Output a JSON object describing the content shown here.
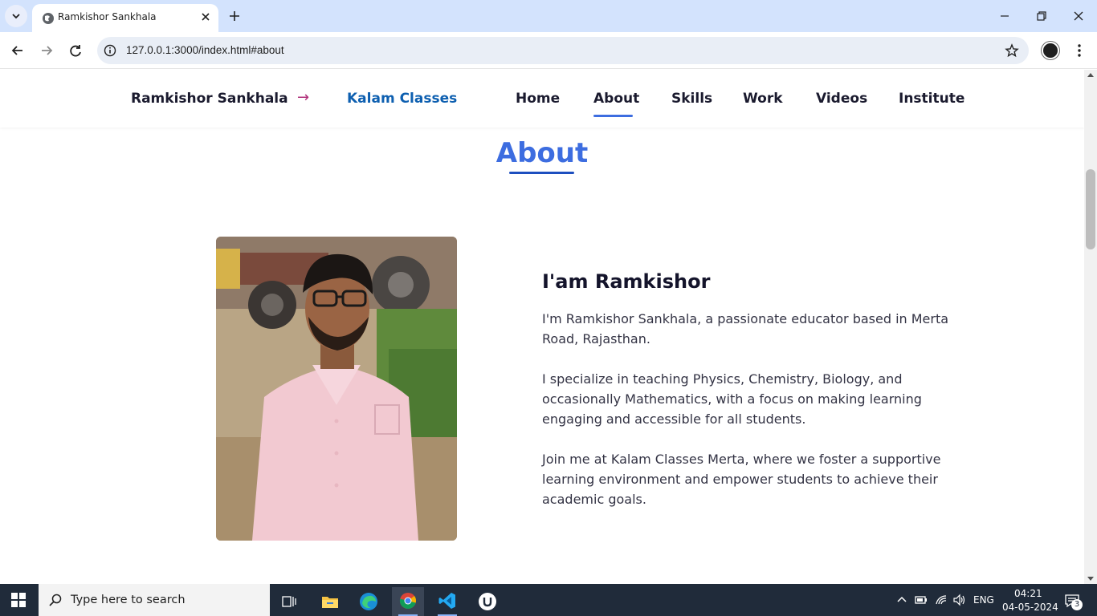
{
  "browser": {
    "tab_title": "Ramkishor Sankhala",
    "url": "127.0.0.1:3000/index.html#about"
  },
  "site": {
    "brand_name": "Ramkishor Sankhala",
    "brand_arrow": "→",
    "brand_link": "Kalam Classes",
    "nav": [
      {
        "label": "Home"
      },
      {
        "label": "About",
        "active": true
      },
      {
        "label": "Skills"
      },
      {
        "label": "Work"
      },
      {
        "label": "Videos"
      },
      {
        "label": "Institute"
      }
    ]
  },
  "about": {
    "section_title": "About",
    "heading": "I'am Ramkishor",
    "paragraphs": [
      "I'm Ramkishor Sankhala, a passionate educator based in Merta Road, Rajasthan.",
      "I specialize in teaching Physics, Chemistry, Biology, and occasionally Mathematics, with a focus on making learning engaging and accessible for all students.",
      "Join me at Kalam Classes Merta, where we foster a supportive learning environment and empower students to achieve their academic goals."
    ]
  },
  "taskbar": {
    "search_placeholder": "Type here to search",
    "language": "ENG",
    "time": "04:21",
    "date": "04-05-2024",
    "notification_count": "3"
  },
  "colors": {
    "accent": "#3d6de0",
    "brand_link": "#0d5fb0",
    "arrow": "#b0307a",
    "tabstrip": "#d3e3fd",
    "taskbar": "#202b3a"
  }
}
